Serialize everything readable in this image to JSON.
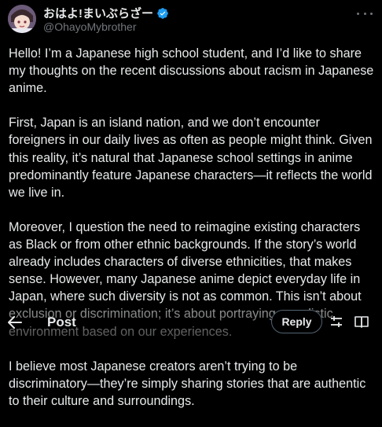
{
  "post": {
    "display_name": "おはよ!まいぶらざー",
    "handle": "@OhayoMybrother",
    "paragraphs": [
      "Hello! I’m a Japanese high school student, and I’d like to share my thoughts on the recent discussions about racism in Japanese anime.",
      "First, Japan is an island nation, and we don’t encounter foreigners in our daily lives as often as people might think. Given this reality, it’s natural that Japanese school settings in anime predominantly feature Japanese characters—it reflects the world we live in.",
      "Moreover, I question the need to reimagine existing characters as Black or from other ethnic backgrounds. If the story’s world already includes characters of diverse ethnicities, that makes sense. However, many Japanese anime depict everyday life in Japan, where such diversity is not as common. This isn’t about exclusion or discrimination; it’s about portraying a realistic environment based on our experiences.",
      "I believe most Japanese creators aren’t trying to be discriminatory—they’re simply sharing stories that are authentic to their culture and surroundings."
    ]
  },
  "toolbar": {
    "title": "Post",
    "reply_label": "Reply"
  },
  "icons": {
    "verified": "verified-badge-icon",
    "more": "more-icon",
    "back": "back-arrow-icon",
    "tune": "tune-icon",
    "reader": "reader-view-icon"
  },
  "colors": {
    "background": "#000000",
    "text": "#e7e9ea",
    "secondary": "#71767b",
    "verified": "#1d9bf0"
  }
}
